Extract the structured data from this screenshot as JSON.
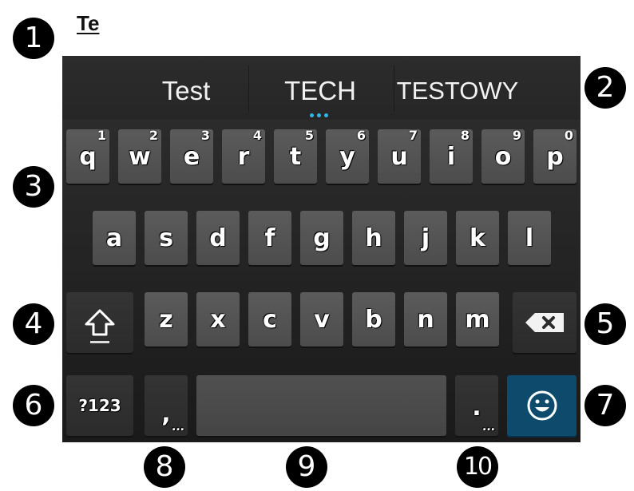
{
  "markers": [
    "1",
    "2",
    "3",
    "4",
    "5",
    "6",
    "7",
    "8",
    "9",
    "10"
  ],
  "typed_text": "Te",
  "suggestions": [
    "Test",
    "TECH",
    "TESTOWY"
  ],
  "rows": {
    "row1": [
      {
        "key": "q",
        "hint": "1"
      },
      {
        "key": "w",
        "hint": "2"
      },
      {
        "key": "e",
        "hint": "3"
      },
      {
        "key": "r",
        "hint": "4"
      },
      {
        "key": "t",
        "hint": "5"
      },
      {
        "key": "y",
        "hint": "6"
      },
      {
        "key": "u",
        "hint": "7"
      },
      {
        "key": "i",
        "hint": "8"
      },
      {
        "key": "o",
        "hint": "9"
      },
      {
        "key": "p",
        "hint": "0"
      }
    ],
    "row2": [
      "a",
      "s",
      "d",
      "f",
      "g",
      "h",
      "j",
      "k",
      "l"
    ],
    "row3": [
      "z",
      "x",
      "c",
      "v",
      "b",
      "n",
      "m"
    ]
  },
  "keys": {
    "symbols_label": "?123",
    "comma_label": ",",
    "period_label": ".",
    "more_dots": "...",
    "space_label": ""
  },
  "icons": {
    "shift": "shift-arrow-icon",
    "backspace": "backspace-icon",
    "emoji": "emoji-smiley-icon"
  },
  "colors": {
    "accent": "#33b5e5",
    "emoji_key": "#0d4a6c"
  }
}
